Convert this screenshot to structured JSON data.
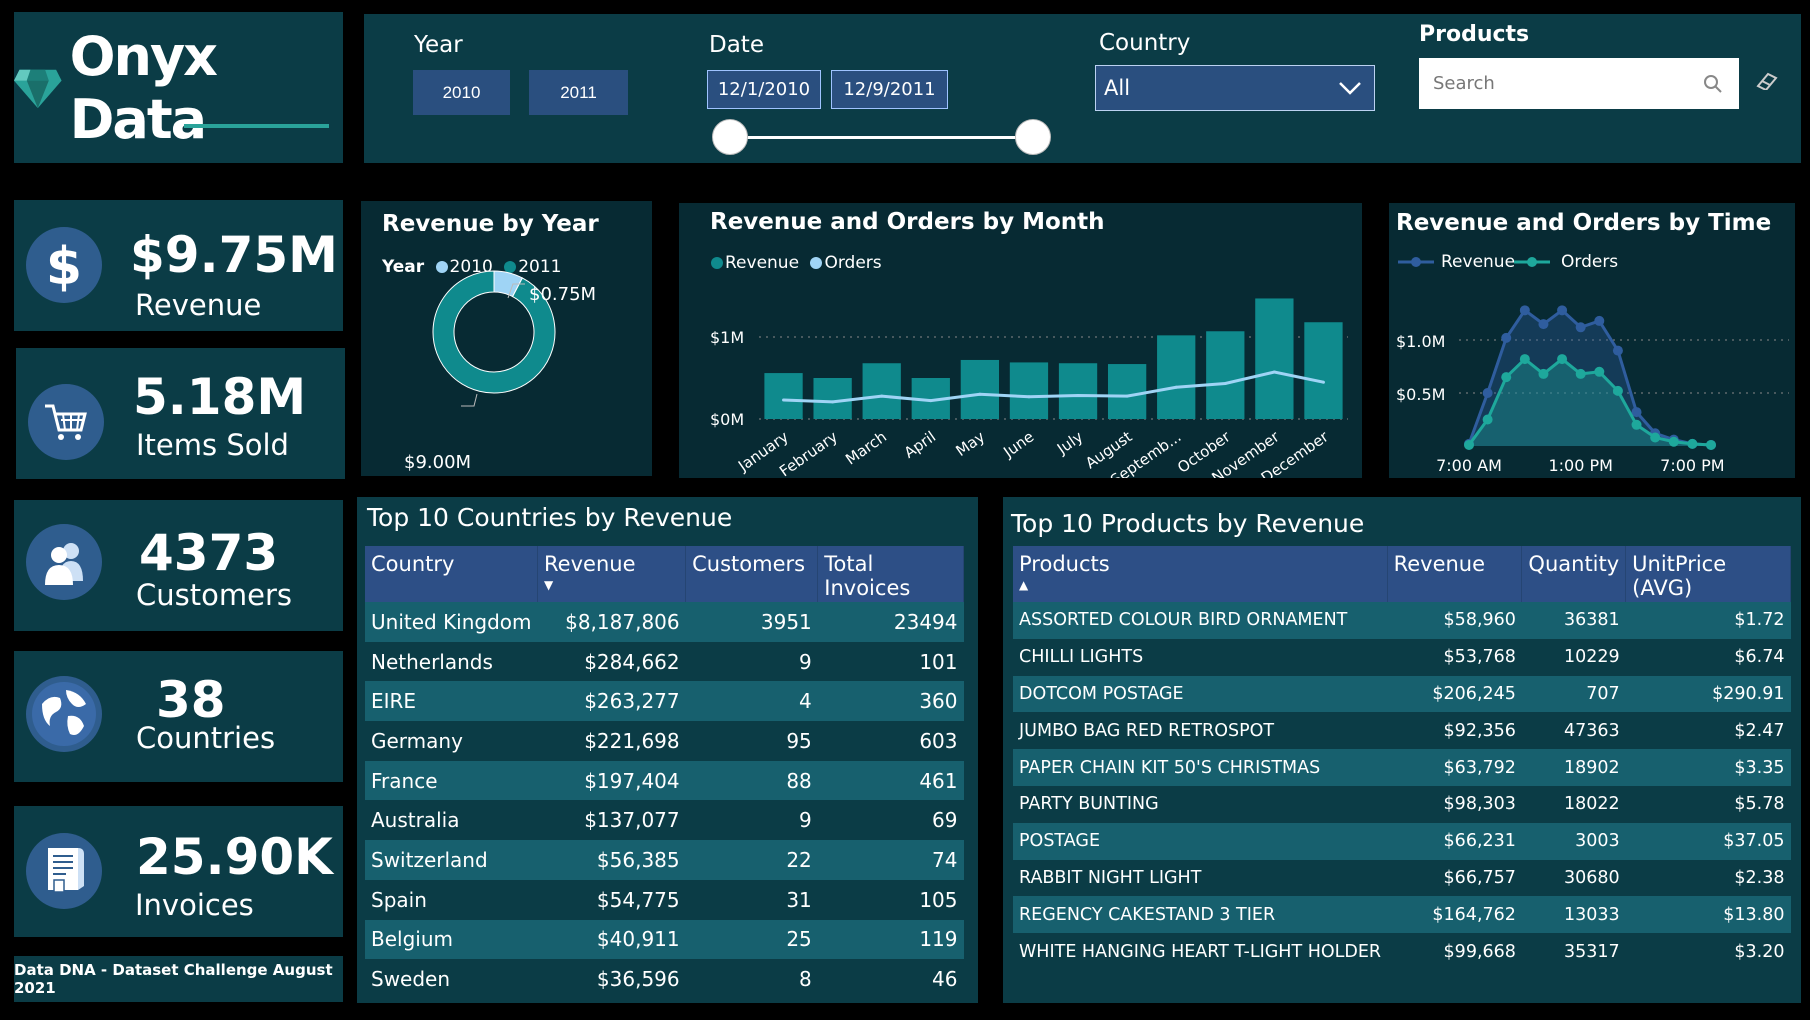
{
  "logo": {
    "text": "Onyx Data"
  },
  "filters": {
    "year_label": "Year",
    "year_options": [
      "2010",
      "2011"
    ],
    "date_label": "Date",
    "date_start": "12/1/2010",
    "date_end": "12/9/2011",
    "country_label": "Country",
    "country_value": "All",
    "products_label": "Products",
    "products_placeholder": "Search"
  },
  "kpis": [
    {
      "value": "$9.75M",
      "label": "Revenue",
      "icon": "dollar-icon"
    },
    {
      "value": "5.18M",
      "label": "Items Sold",
      "icon": "cart-icon"
    },
    {
      "value": "4373",
      "label": "Customers",
      "icon": "users-icon"
    },
    {
      "value": "38",
      "label": "Countries",
      "icon": "globe-icon"
    },
    {
      "value": "25.90K",
      "label": "Invoices",
      "icon": "invoice-icon"
    }
  ],
  "footer": {
    "challenge": "Data DNA - Dataset Challenge August 2021"
  },
  "chart_data": [
    {
      "type": "pie",
      "title": "Revenue by Year",
      "legend_title": "Year",
      "categories": [
        "2010",
        "2011"
      ],
      "values": [
        0.75,
        9.0
      ],
      "labels": [
        "$0.75M",
        "$9.00M"
      ],
      "colors": [
        "#9fd4f5",
        "#0f8a8d"
      ]
    },
    {
      "type": "bar",
      "title": "Revenue and Orders by Month",
      "categories": [
        "January",
        "February",
        "March",
        "April",
        "May",
        "June",
        "July",
        "August",
        "Septemb...",
        "October",
        "November",
        "December"
      ],
      "y_ticks": [
        "$0M",
        "$1M"
      ],
      "series": [
        {
          "name": "Revenue",
          "type": "bar",
          "color": "#0f8a8d",
          "values": [
            0.56,
            0.5,
            0.68,
            0.5,
            0.72,
            0.69,
            0.68,
            0.67,
            1.02,
            1.07,
            1.47,
            1.18
          ]
        },
        {
          "name": "Orders",
          "type": "line",
          "color": "#9fd4f5",
          "values": [
            1500,
            1350,
            1800,
            1450,
            1950,
            1750,
            1850,
            1800,
            2500,
            2800,
            3700,
            2900
          ]
        }
      ]
    },
    {
      "type": "line",
      "title": "Revenue and Orders by Time",
      "x_ticks": [
        "7:00 AM",
        "1:00 PM",
        "7:00 PM"
      ],
      "x": [
        7,
        8,
        9,
        10,
        11,
        12,
        13,
        14,
        15,
        16,
        17,
        18,
        19,
        20
      ],
      "y_ticks": [
        "$0.5M",
        "$1.0M"
      ],
      "series": [
        {
          "name": "Revenue",
          "color": "#2f5d9e",
          "values": [
            0.02,
            0.5,
            1.02,
            1.28,
            1.15,
            1.28,
            1.12,
            1.18,
            0.9,
            0.32,
            0.12,
            0.06,
            0.02,
            0.01
          ]
        },
        {
          "name": "Orders",
          "color": "#1ea89c",
          "values": [
            0.01,
            0.25,
            0.65,
            0.82,
            0.68,
            0.82,
            0.68,
            0.7,
            0.52,
            0.2,
            0.08,
            0.04,
            0.02,
            0.01
          ]
        }
      ]
    }
  ],
  "countries_table": {
    "title": "Top 10 Countries by Revenue",
    "headers": [
      "Country",
      "Revenue",
      "Customers",
      "Total Invoices"
    ],
    "rows": [
      [
        "United Kingdom",
        "$8,187,806",
        "3951",
        "23494"
      ],
      [
        "Netherlands",
        "$284,662",
        "9",
        "101"
      ],
      [
        "EIRE",
        "$263,277",
        "4",
        "360"
      ],
      [
        "Germany",
        "$221,698",
        "95",
        "603"
      ],
      [
        "France",
        "$197,404",
        "88",
        "461"
      ],
      [
        "Australia",
        "$137,077",
        "9",
        "69"
      ],
      [
        "Switzerland",
        "$56,385",
        "22",
        "74"
      ],
      [
        "Spain",
        "$54,775",
        "31",
        "105"
      ],
      [
        "Belgium",
        "$40,911",
        "25",
        "119"
      ],
      [
        "Sweden",
        "$36,596",
        "8",
        "46"
      ]
    ]
  },
  "products_table": {
    "title": "Top 10 Products by Revenue",
    "headers": [
      "Products",
      "Revenue",
      "Quantity",
      "UnitPrice (AVG)"
    ],
    "rows": [
      [
        "ASSORTED COLOUR BIRD ORNAMENT",
        "$58,960",
        "36381",
        "$1.72"
      ],
      [
        "CHILLI LIGHTS",
        "$53,768",
        "10229",
        "$6.74"
      ],
      [
        "DOTCOM POSTAGE",
        "$206,245",
        "707",
        "$290.91"
      ],
      [
        "JUMBO BAG RED RETROSPOT",
        "$92,356",
        "47363",
        "$2.47"
      ],
      [
        "PAPER CHAIN KIT 50'S CHRISTMAS",
        "$63,792",
        "18902",
        "$3.35"
      ],
      [
        "PARTY BUNTING",
        "$98,303",
        "18022",
        "$5.78"
      ],
      [
        "POSTAGE",
        "$66,231",
        "3003",
        "$37.05"
      ],
      [
        "RABBIT NIGHT LIGHT",
        "$66,757",
        "30680",
        "$2.38"
      ],
      [
        "REGENCY CAKESTAND 3 TIER",
        "$164,762",
        "13033",
        "$13.80"
      ],
      [
        "WHITE HANGING HEART T-LIGHT HOLDER",
        "$99,668",
        "35317",
        "$3.20"
      ]
    ]
  }
}
